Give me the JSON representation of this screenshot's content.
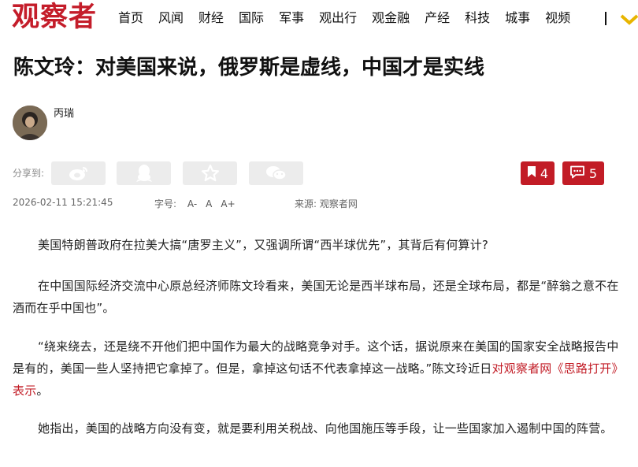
{
  "header": {
    "logo": "观察者",
    "nav": [
      "首页",
      "风闻",
      "财经",
      "国际",
      "军事",
      "观出行",
      "观金融",
      "产经",
      "科技",
      "城事",
      "视频"
    ]
  },
  "article": {
    "title": "陈文玲：对美国来说，俄罗斯是虚线，中国才是实线",
    "author": "丙瑞",
    "share_label": "分享到:",
    "bookmark_count": "4",
    "comment_count": "5",
    "date": "2026-02-11 15:21:45",
    "font_size_label": "字号:",
    "font_sizes": [
      "A-",
      "A",
      "A+"
    ],
    "source_label": "来源:",
    "source": "观察者网",
    "paragraphs": {
      "p1": "美国特朗普政府在拉美大搞“唐罗主义”，又强调所谓“西半球优先”，其背后有何算计?",
      "p2": "在中国国际经济交流中心原总经济师陈文玲看来，美国无论是西半球布局，还是全球布局，都是“醉翁之意不在酒而在乎中国也”。",
      "p3_text": "“绕来绕去，还是绕不开他们把中国作为最大的战略竞争对手。这个话，据说原来在美国的国家安全战略报告中是有的，美国一些人坚持把它拿掉了。但是，拿掉这句话不代表拿掉这一战略。”陈文玲近日",
      "p3_link": "对观察者网《思路打开》表示",
      "p3_end": "。",
      "p4": "她指出，美国的战略方向没有变，就是要利用关税战、向他国施压等手段，让一些国家加入遏制中国的阵营。"
    }
  },
  "colors": {
    "brand": "#c41d2a",
    "button": "#c21c26",
    "share_bg": "#ececec"
  },
  "icons": [
    "weibo-icon",
    "qq-icon",
    "qzone-star-icon",
    "wechat-icon",
    "bookmark-icon",
    "comment-icon",
    "chevron-down-icon"
  ]
}
